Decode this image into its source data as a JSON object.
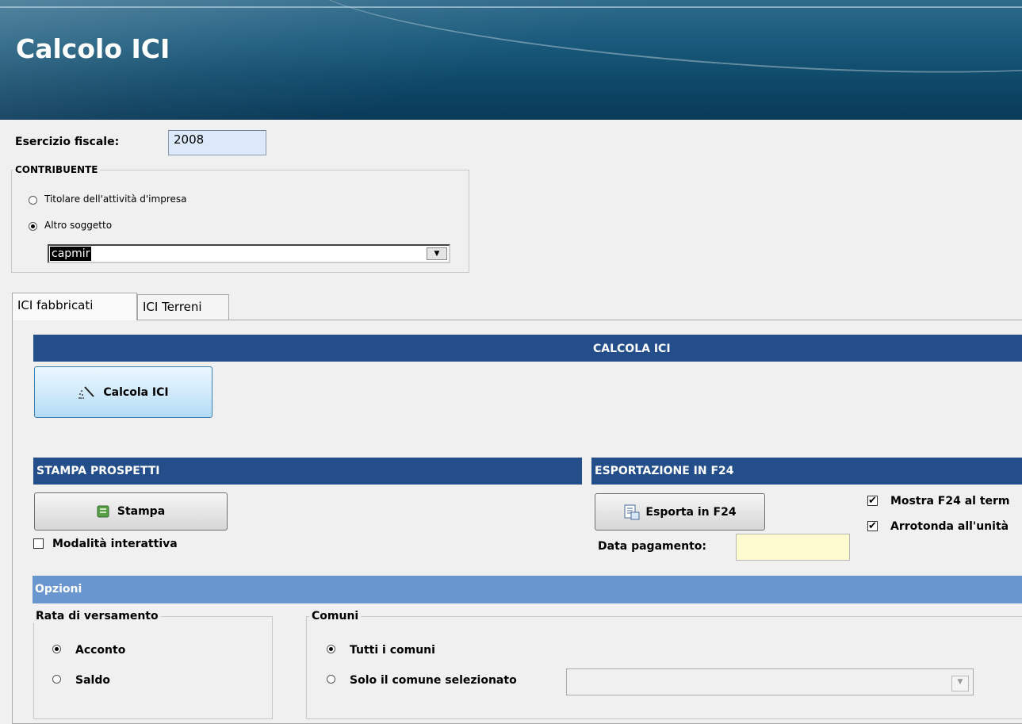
{
  "window": {
    "title": "Calcolo ICI"
  },
  "fiscal_year": {
    "label": "Esercizio fiscale:",
    "value": "2008"
  },
  "contribuente": {
    "legend": "CONTRIBUENTE",
    "options": [
      {
        "label": "Titolare dell'attività d'impresa",
        "selected": false
      },
      {
        "label": "Altro soggetto",
        "selected": true
      }
    ],
    "combo_value": "capmir"
  },
  "tabs": [
    {
      "label": "ICI fabbricati",
      "active": true
    },
    {
      "label": "ICI Terreni",
      "active": false
    }
  ],
  "calcola": {
    "header": "CALCOLA ICI",
    "button_label": "Calcola ICI"
  },
  "stampa": {
    "header": "STAMPA PROSPETTI",
    "button_label": "Stampa",
    "interactive_label": "Modalità interattiva",
    "interactive_checked": false
  },
  "export": {
    "header": "ESPORTAZIONE IN F24",
    "button_label": "Esporta in F24",
    "date_label": "Data pagamento:",
    "date_value": "",
    "show_label": "Mostra F24 al term",
    "show_checked": true,
    "round_label": "Arrotonda all'unità",
    "round_checked": true
  },
  "opzioni": {
    "header": "Opzioni",
    "rata": {
      "legend": "Rata di versamento",
      "options": [
        {
          "label": "Acconto",
          "selected": true
        },
        {
          "label": "Saldo",
          "selected": false
        }
      ]
    },
    "comuni": {
      "legend": "Comuni",
      "options": [
        {
          "label": "Tutti i comuni",
          "selected": true
        },
        {
          "label": "Solo il comune selezionato",
          "selected": false
        }
      ],
      "combo_value": ""
    }
  },
  "colors": {
    "header_dark": "#244e8a",
    "header_light": "#6a96cf",
    "title_bar": "#0f4a6a"
  },
  "icons": {
    "calcola": "wand-icon",
    "stampa": "print-icon",
    "export": "export-icon",
    "dropdown": "chevron-down-icon"
  }
}
